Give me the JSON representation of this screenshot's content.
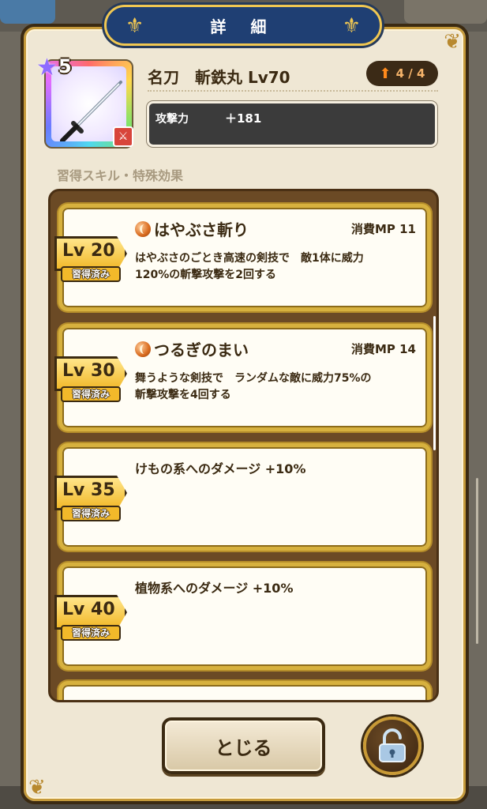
{
  "header": {
    "title": "詳 細"
  },
  "item": {
    "rarity": "5",
    "name": "名刀　斬鉄丸 Lv70",
    "upgrade": "4 / 4",
    "stat_label": "攻撃力",
    "stat_value": "＋181"
  },
  "section_title": "習得スキル・特殊効果",
  "skills": [
    {
      "lv": "Lv 20",
      "status": "習得済み",
      "name": "はやぶさ斬り",
      "mp": "消費MP 11",
      "desc_line1": "はやぶさのごとき高速の剣技で　敵1体に威力",
      "desc_line2": "120%の斬撃攻撃を2回する"
    },
    {
      "lv": "Lv 30",
      "status": "習得済み",
      "name": "つるぎのまい",
      "mp": "消費MP 14",
      "desc_line1": "舞うような剣技で　ランダムな敵に威力75%の",
      "desc_line2": "斬撃攻撃を4回する"
    },
    {
      "lv": "Lv 35",
      "status": "習得済み",
      "effect": "けもの系へのダメージ +10%"
    },
    {
      "lv": "Lv 40",
      "status": "習得済み",
      "effect": "植物系へのダメージ +10%"
    }
  ],
  "buttons": {
    "close": "とじる"
  },
  "colors": {
    "accent_gold": "#d7b13e",
    "header_blue": "#1f3f73",
    "panel": "#efe7d4"
  }
}
